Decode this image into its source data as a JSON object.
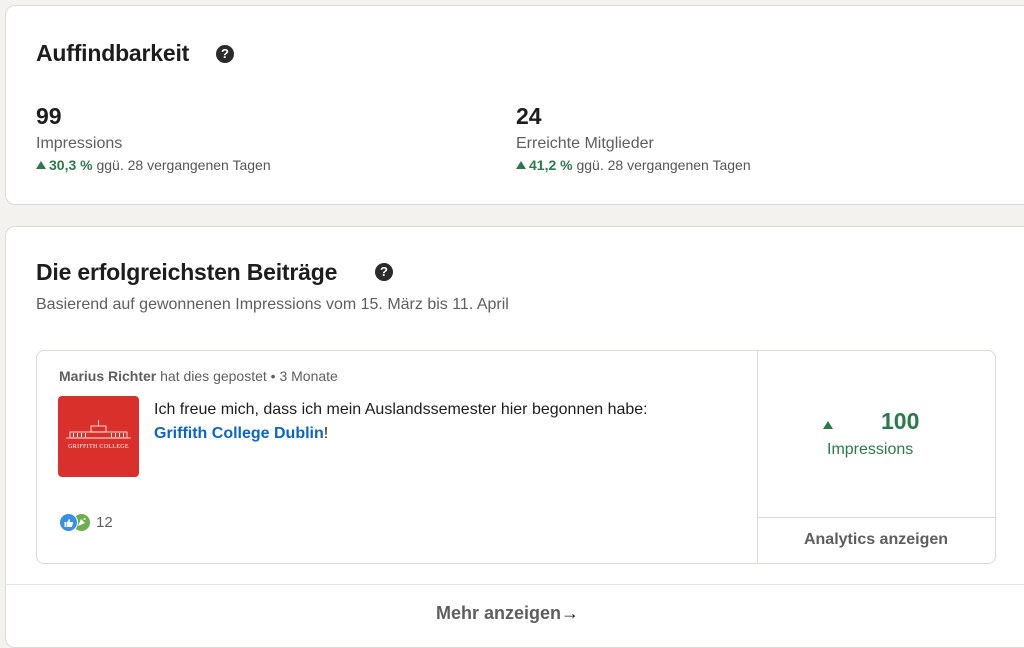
{
  "discoverability": {
    "title": "Auffindbarkeit",
    "help_icon": "?",
    "metrics": [
      {
        "value": "99",
        "label": "Impressions",
        "change": "30,3 %",
        "change_suffix": "ggü. 28 vergangenen Tagen",
        "trend": "up"
      },
      {
        "value": "24",
        "label": "Erreichte Mitglieder",
        "change": "41,2 %",
        "change_suffix": "ggü. 28 vergangenen Tagen",
        "trend": "up"
      }
    ]
  },
  "top_posts": {
    "title": "Die erfolgreichsten Beiträge",
    "help_icon": "?",
    "subtitle": "Basierend auf gewonnenen Impressions vom 15. März bis 11. April",
    "post": {
      "author": "Marius Richter",
      "meta": "hat dies gepostet • 3 Monate",
      "text_before": "Ich freue mich, dass ich mein Auslandssemester hier begonnen habe: ",
      "link": "Griffith College Dublin",
      "text_after": "!",
      "logo_text": "GRIFFITH COLLEGE",
      "reaction_icons": [
        "like-icon",
        "celebrate-icon"
      ],
      "reaction_count": "12",
      "impressions_value": "100",
      "impressions_label": "Impressions",
      "analytics_button": "Analytics anzeigen"
    },
    "more_button": "Mehr anzeigen",
    "more_arrow": "→"
  },
  "colors": {
    "positive": "#2b7a4b",
    "link": "#0a66c2",
    "logo_bg": "#d9302b",
    "page_bg": "#f4f2ee"
  }
}
